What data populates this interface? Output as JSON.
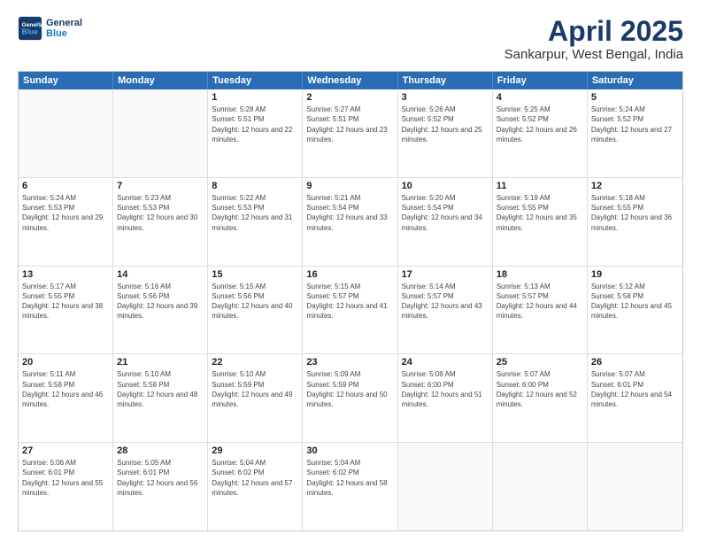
{
  "header": {
    "logo_line1": "General",
    "logo_line2": "Blue",
    "month_year": "April 2025",
    "location": "Sankarpur, West Bengal, India"
  },
  "weekdays": [
    "Sunday",
    "Monday",
    "Tuesday",
    "Wednesday",
    "Thursday",
    "Friday",
    "Saturday"
  ],
  "rows": [
    [
      {
        "day": "",
        "sunrise": "",
        "sunset": "",
        "daylight": ""
      },
      {
        "day": "",
        "sunrise": "",
        "sunset": "",
        "daylight": ""
      },
      {
        "day": "1",
        "sunrise": "Sunrise: 5:28 AM",
        "sunset": "Sunset: 5:51 PM",
        "daylight": "Daylight: 12 hours and 22 minutes."
      },
      {
        "day": "2",
        "sunrise": "Sunrise: 5:27 AM",
        "sunset": "Sunset: 5:51 PM",
        "daylight": "Daylight: 12 hours and 23 minutes."
      },
      {
        "day": "3",
        "sunrise": "Sunrise: 5:26 AM",
        "sunset": "Sunset: 5:52 PM",
        "daylight": "Daylight: 12 hours and 25 minutes."
      },
      {
        "day": "4",
        "sunrise": "Sunrise: 5:25 AM",
        "sunset": "Sunset: 5:52 PM",
        "daylight": "Daylight: 12 hours and 26 minutes."
      },
      {
        "day": "5",
        "sunrise": "Sunrise: 5:24 AM",
        "sunset": "Sunset: 5:52 PM",
        "daylight": "Daylight: 12 hours and 27 minutes."
      }
    ],
    [
      {
        "day": "6",
        "sunrise": "Sunrise: 5:24 AM",
        "sunset": "Sunset: 5:53 PM",
        "daylight": "Daylight: 12 hours and 29 minutes."
      },
      {
        "day": "7",
        "sunrise": "Sunrise: 5:23 AM",
        "sunset": "Sunset: 5:53 PM",
        "daylight": "Daylight: 12 hours and 30 minutes."
      },
      {
        "day": "8",
        "sunrise": "Sunrise: 5:22 AM",
        "sunset": "Sunset: 5:53 PM",
        "daylight": "Daylight: 12 hours and 31 minutes."
      },
      {
        "day": "9",
        "sunrise": "Sunrise: 5:21 AM",
        "sunset": "Sunset: 5:54 PM",
        "daylight": "Daylight: 12 hours and 33 minutes."
      },
      {
        "day": "10",
        "sunrise": "Sunrise: 5:20 AM",
        "sunset": "Sunset: 5:54 PM",
        "daylight": "Daylight: 12 hours and 34 minutes."
      },
      {
        "day": "11",
        "sunrise": "Sunrise: 5:19 AM",
        "sunset": "Sunset: 5:55 PM",
        "daylight": "Daylight: 12 hours and 35 minutes."
      },
      {
        "day": "12",
        "sunrise": "Sunrise: 5:18 AM",
        "sunset": "Sunset: 5:55 PM",
        "daylight": "Daylight: 12 hours and 36 minutes."
      }
    ],
    [
      {
        "day": "13",
        "sunrise": "Sunrise: 5:17 AM",
        "sunset": "Sunset: 5:55 PM",
        "daylight": "Daylight: 12 hours and 38 minutes."
      },
      {
        "day": "14",
        "sunrise": "Sunrise: 5:16 AM",
        "sunset": "Sunset: 5:56 PM",
        "daylight": "Daylight: 12 hours and 39 minutes."
      },
      {
        "day": "15",
        "sunrise": "Sunrise: 5:15 AM",
        "sunset": "Sunset: 5:56 PM",
        "daylight": "Daylight: 12 hours and 40 minutes."
      },
      {
        "day": "16",
        "sunrise": "Sunrise: 5:15 AM",
        "sunset": "Sunset: 5:57 PM",
        "daylight": "Daylight: 12 hours and 41 minutes."
      },
      {
        "day": "17",
        "sunrise": "Sunrise: 5:14 AM",
        "sunset": "Sunset: 5:57 PM",
        "daylight": "Daylight: 12 hours and 43 minutes."
      },
      {
        "day": "18",
        "sunrise": "Sunrise: 5:13 AM",
        "sunset": "Sunset: 5:57 PM",
        "daylight": "Daylight: 12 hours and 44 minutes."
      },
      {
        "day": "19",
        "sunrise": "Sunrise: 5:12 AM",
        "sunset": "Sunset: 5:58 PM",
        "daylight": "Daylight: 12 hours and 45 minutes."
      }
    ],
    [
      {
        "day": "20",
        "sunrise": "Sunrise: 5:11 AM",
        "sunset": "Sunset: 5:58 PM",
        "daylight": "Daylight: 12 hours and 46 minutes."
      },
      {
        "day": "21",
        "sunrise": "Sunrise: 5:10 AM",
        "sunset": "Sunset: 5:58 PM",
        "daylight": "Daylight: 12 hours and 48 minutes."
      },
      {
        "day": "22",
        "sunrise": "Sunrise: 5:10 AM",
        "sunset": "Sunset: 5:59 PM",
        "daylight": "Daylight: 12 hours and 49 minutes."
      },
      {
        "day": "23",
        "sunrise": "Sunrise: 5:09 AM",
        "sunset": "Sunset: 5:59 PM",
        "daylight": "Daylight: 12 hours and 50 minutes."
      },
      {
        "day": "24",
        "sunrise": "Sunrise: 5:08 AM",
        "sunset": "Sunset: 6:00 PM",
        "daylight": "Daylight: 12 hours and 51 minutes."
      },
      {
        "day": "25",
        "sunrise": "Sunrise: 5:07 AM",
        "sunset": "Sunset: 6:00 PM",
        "daylight": "Daylight: 12 hours and 52 minutes."
      },
      {
        "day": "26",
        "sunrise": "Sunrise: 5:07 AM",
        "sunset": "Sunset: 6:01 PM",
        "daylight": "Daylight: 12 hours and 54 minutes."
      }
    ],
    [
      {
        "day": "27",
        "sunrise": "Sunrise: 5:06 AM",
        "sunset": "Sunset: 6:01 PM",
        "daylight": "Daylight: 12 hours and 55 minutes."
      },
      {
        "day": "28",
        "sunrise": "Sunrise: 5:05 AM",
        "sunset": "Sunset: 6:01 PM",
        "daylight": "Daylight: 12 hours and 56 minutes."
      },
      {
        "day": "29",
        "sunrise": "Sunrise: 5:04 AM",
        "sunset": "Sunset: 6:02 PM",
        "daylight": "Daylight: 12 hours and 57 minutes."
      },
      {
        "day": "30",
        "sunrise": "Sunrise: 5:04 AM",
        "sunset": "Sunset: 6:02 PM",
        "daylight": "Daylight: 12 hours and 58 minutes."
      },
      {
        "day": "",
        "sunrise": "",
        "sunset": "",
        "daylight": ""
      },
      {
        "day": "",
        "sunrise": "",
        "sunset": "",
        "daylight": ""
      },
      {
        "day": "",
        "sunrise": "",
        "sunset": "",
        "daylight": ""
      }
    ]
  ]
}
